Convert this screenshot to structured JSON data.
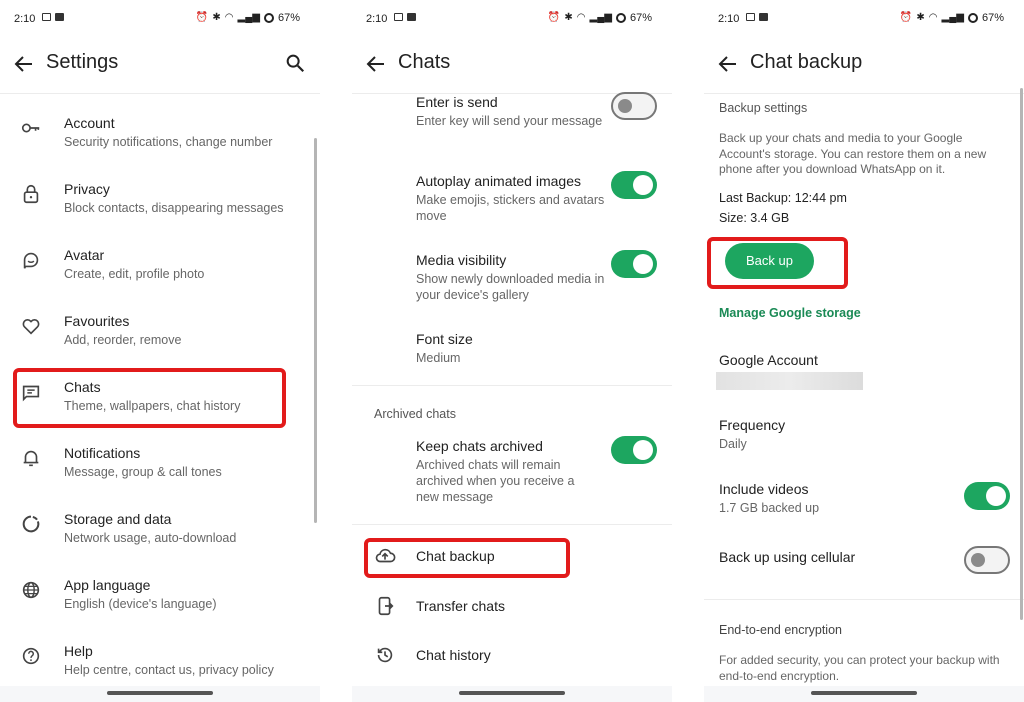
{
  "status_bar": {
    "time": "2:10",
    "battery": "67%"
  },
  "settings_screen": {
    "title": "Settings",
    "items": [
      {
        "icon": "key-icon",
        "title": "Account",
        "subtitle": "Security notifications, change number"
      },
      {
        "icon": "lock-icon",
        "title": "Privacy",
        "subtitle": "Block contacts, disappearing messages"
      },
      {
        "icon": "avatar-icon",
        "title": "Avatar",
        "subtitle": "Create, edit, profile photo"
      },
      {
        "icon": "heart-icon",
        "title": "Favourites",
        "subtitle": "Add, reorder, remove"
      },
      {
        "icon": "chat-icon",
        "title": "Chats",
        "subtitle": "Theme, wallpapers, chat history"
      },
      {
        "icon": "bell-icon",
        "title": "Notifications",
        "subtitle": "Message, group & call tones"
      },
      {
        "icon": "storage-icon",
        "title": "Storage and data",
        "subtitle": "Network usage, auto-download"
      },
      {
        "icon": "globe-icon",
        "title": "App language",
        "subtitle": "English (device's language)"
      },
      {
        "icon": "help-icon",
        "title": "Help",
        "subtitle": "Help centre, contact us, privacy policy"
      }
    ]
  },
  "chats_screen": {
    "title": "Chats",
    "settings": [
      {
        "title": "Enter is send",
        "subtitle": "Enter key will send your message",
        "toggle": false
      },
      {
        "title": "Autoplay animated images",
        "subtitle": "Make emojis, stickers and avatars move",
        "toggle": true
      },
      {
        "title": "Media visibility",
        "subtitle": "Show newly downloaded media in your device's gallery",
        "toggle": true
      },
      {
        "title": "Font size",
        "subtitle": "Medium"
      }
    ],
    "archived_label": "Archived chats",
    "archived": {
      "title": "Keep chats archived",
      "subtitle": "Archived chats will remain archived when you receive a new message",
      "toggle": true
    },
    "items": [
      {
        "icon": "cloud-upload-icon",
        "title": "Chat backup"
      },
      {
        "icon": "transfer-icon",
        "title": "Transfer chats"
      },
      {
        "icon": "history-icon",
        "title": "Chat history"
      }
    ]
  },
  "backup_screen": {
    "title": "Chat backup",
    "section_label": "Backup settings",
    "description": "Back up your chats and media to your Google Account's storage. You can restore them on a new phone after you download WhatsApp on it.",
    "last_backup": "Last Backup: 12:44 pm",
    "size": "Size: 3.4 GB",
    "backup_button": "Back up",
    "manage_link": "Manage Google storage",
    "google_account_label": "Google Account",
    "frequency": {
      "title": "Frequency",
      "value": "Daily"
    },
    "include_videos": {
      "title": "Include videos",
      "subtitle": "1.7 GB backed up",
      "toggle": true
    },
    "cellular": {
      "title": "Back up using cellular",
      "toggle": false
    },
    "e2e_label": "End-to-end encryption",
    "e2e_description": "For added security, you can protect your backup with end-to-end encryption."
  },
  "colors": {
    "accent": "#1da660",
    "highlight": "#e21b1b",
    "link": "#1a8a55"
  }
}
